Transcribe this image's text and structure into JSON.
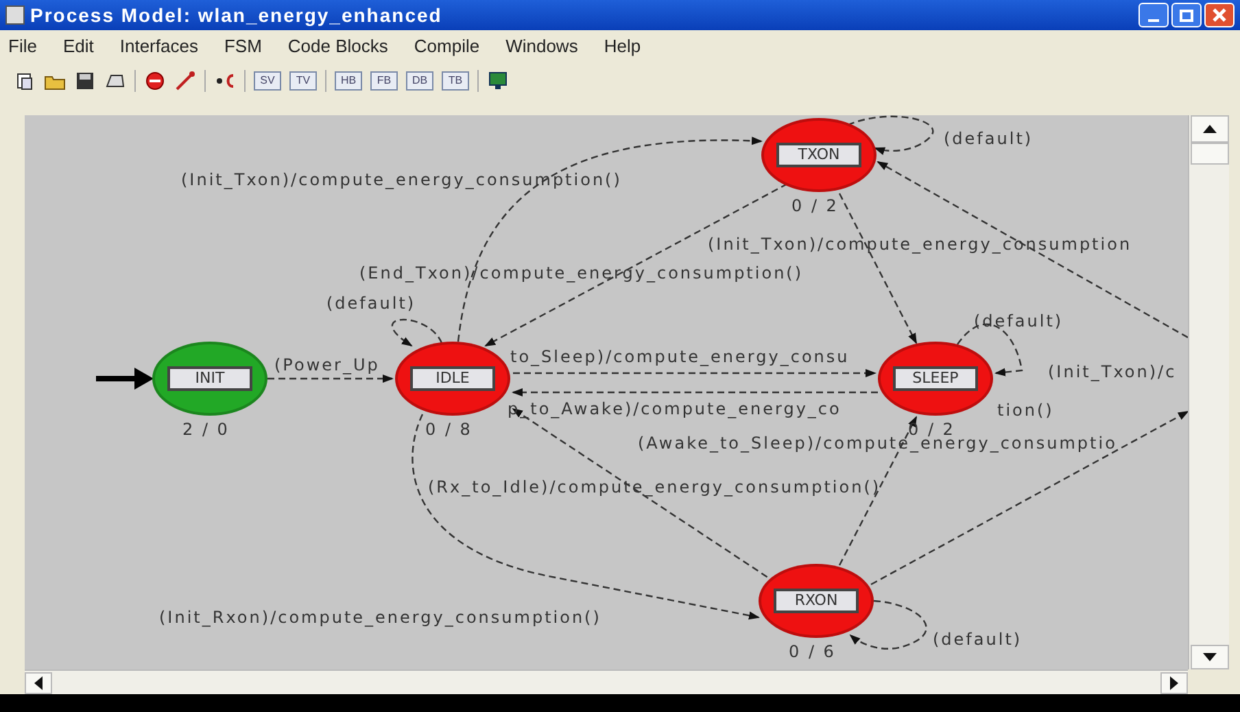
{
  "window": {
    "title": "Process Model: wlan_energy_enhanced"
  },
  "menu": [
    "File",
    "Edit",
    "Interfaces",
    "FSM",
    "Code Blocks",
    "Compile",
    "Windows",
    "Help"
  ],
  "toolbar": [
    {
      "kind": "icon"
    },
    {
      "kind": "icon"
    },
    {
      "kind": "icon"
    },
    {
      "kind": "icon"
    },
    {
      "kind": "separator"
    },
    {
      "kind": "icon"
    },
    {
      "kind": "icon"
    },
    {
      "kind": "separator"
    },
    {
      "kind": "icon"
    },
    {
      "kind": "separator"
    },
    {
      "kind": "text",
      "label": "SV"
    },
    {
      "kind": "text",
      "label": "TV"
    },
    {
      "kind": "separator"
    },
    {
      "kind": "text",
      "label": "HB"
    },
    {
      "kind": "text",
      "label": "FB"
    },
    {
      "kind": "text",
      "label": "DB"
    },
    {
      "kind": "text",
      "label": "TB"
    },
    {
      "kind": "separator"
    },
    {
      "kind": "icon"
    }
  ],
  "states": [
    {
      "name": "INIT",
      "counts": "2 / 0",
      "color": "#22a826"
    },
    {
      "name": "IDLE",
      "counts": "0 / 8",
      "color": "#ee1111"
    },
    {
      "name": "TXON",
      "counts": "0 / 2",
      "color": "#ee1111"
    },
    {
      "name": "SLEEP",
      "counts": "0 / 2",
      "color": "#ee1111"
    },
    {
      "name": "RXON",
      "counts": "0 / 6",
      "color": "#ee1111"
    }
  ],
  "transitions": [
    {
      "label": "(default)"
    },
    {
      "label": "(Init_Txon)/compute_energy_consumption()"
    },
    {
      "label": "(Init_Txon)/compute_energy_consumption"
    },
    {
      "label": "(End_Txon)/compute_energy_consumption()"
    },
    {
      "label": "(default)"
    },
    {
      "label": "(default)"
    },
    {
      "label": "(Power_Up"
    },
    {
      "label": "to_Sleep)/compute_energy_consu"
    },
    {
      "label": "(Init_Txon)/c"
    },
    {
      "label": "p_to_Awake)/compute_energy_co"
    },
    {
      "label": "tion()"
    },
    {
      "label": "(Awake_to_Sleep)/compute_energy_consumptio"
    },
    {
      "label": "(Rx_to_Idle)/compute_energy_consumption()"
    },
    {
      "label": "(Init_Rxon)/compute_energy_consumption()"
    },
    {
      "label": "(default)"
    }
  ]
}
